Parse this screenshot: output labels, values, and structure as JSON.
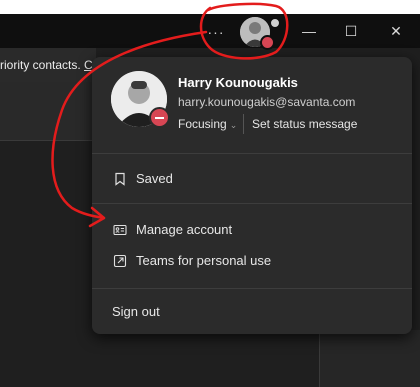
{
  "topbar": {
    "more_label": "···",
    "minimize_label": "—",
    "maximize_label": "☐",
    "close_label": "✕"
  },
  "banner": {
    "text": "riority contacts.",
    "link": "Cl"
  },
  "profile": {
    "name": "Harry Kounougakis",
    "email": "harry.kounougakis@savanta.com",
    "status": "Focusing",
    "set_status": "Set status message"
  },
  "menu": {
    "saved": "Saved",
    "manage_account": "Manage account",
    "teams_personal": "Teams for personal use",
    "sign_out": "Sign out"
  },
  "colors": {
    "status_red": "#d74654",
    "annotation_red": "#e31c1c",
    "menu_bg": "#2b2b2b"
  }
}
